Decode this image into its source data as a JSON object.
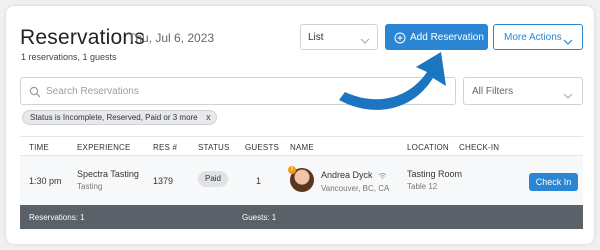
{
  "header": {
    "title": "Reservations",
    "date": "Thu, Jul 6, 2023",
    "summary": "1 reservations, 1 guests"
  },
  "toolbar": {
    "view_value": "List",
    "add_label": "Add Reservation",
    "more_label": "More Actions"
  },
  "search": {
    "placeholder": "Search Reservations",
    "filters_value": "All Filters"
  },
  "chip": {
    "label": "Status is Incomplete, Reserved, Paid or 3 more",
    "close": "x"
  },
  "table": {
    "columns": [
      "TIME",
      "EXPERIENCE",
      "RES #",
      "STATUS",
      "GUESTS",
      "NAME",
      "LOCATION",
      "CHECK-IN"
    ],
    "rows": [
      {
        "time": "1:30 pm",
        "experience": "Spectra Tasting",
        "experience_sub": "Tasting",
        "res_no": "1379",
        "status": "Paid",
        "guests": "1",
        "badge": "!",
        "name": "Andrea Dyck",
        "name_sub": "Vancouver, BC, CA",
        "location": "Tasting Room",
        "location_sub": "Table 12",
        "checkin_label": "Check In"
      }
    ]
  },
  "footer": {
    "reservations": "Reservations: 1",
    "guests": "Guests: 1"
  },
  "icons": {
    "plus": "plus-circle-icon",
    "search": "search-icon",
    "chevron": "chevron-down-icon",
    "arrow": "annotation-arrow-icon"
  },
  "colors": {
    "accent": "#2a86d3",
    "footer": "#5a6168",
    "badge": "#f39c12"
  }
}
